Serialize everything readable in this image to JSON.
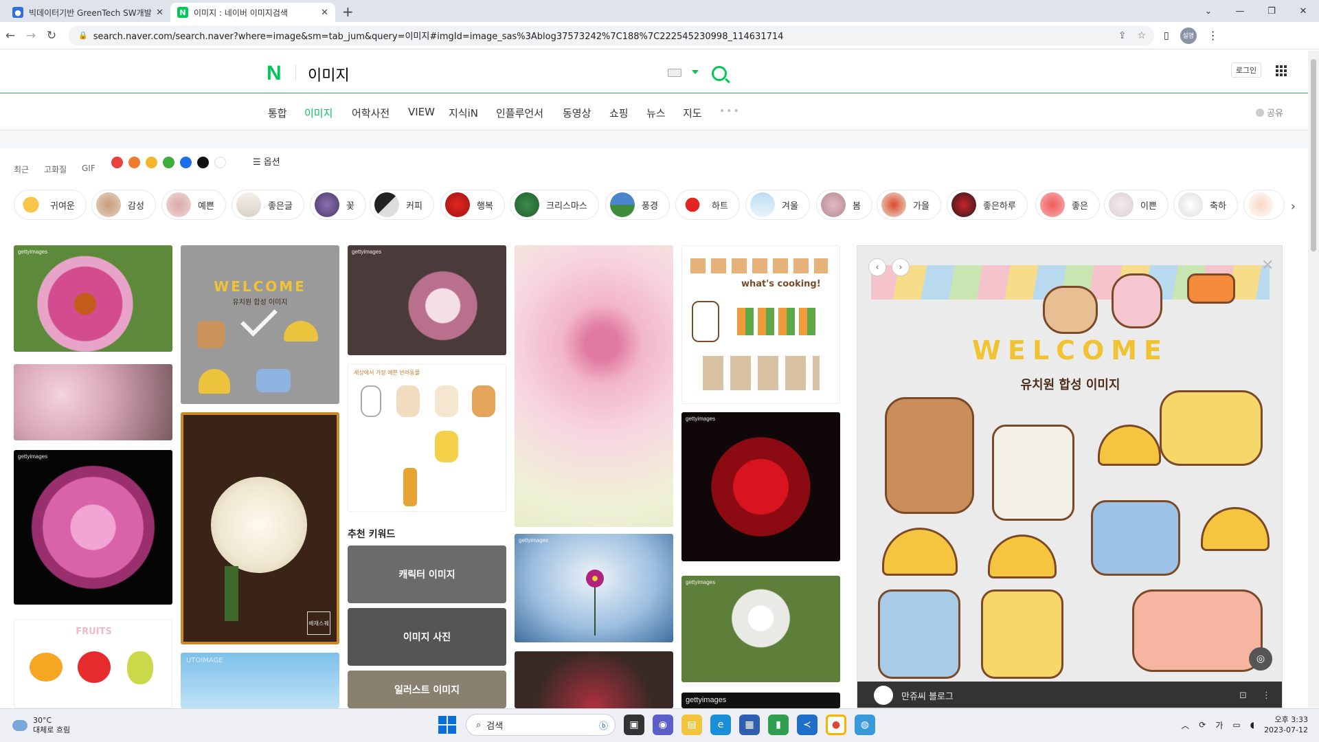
{
  "browser": {
    "tabs": [
      {
        "title": "빅데이터기반 GreenTech SW개발",
        "favicon": "blue-person-icon"
      },
      {
        "title": "이미지 : 네이버 이미지검색",
        "favicon": "naver-n-icon"
      }
    ],
    "url": "search.naver.com/search.naver?where=image&sm=tab_jum&query=이미지#imgId=image_sas%3Ablog37573242%7C188%7C222545230998_114631714",
    "profile_initial": "설명"
  },
  "naver": {
    "logo": "N",
    "query": "이미지",
    "login": "로그인",
    "tabs": [
      "통합",
      "이미지",
      "어학사전",
      "VIEW",
      "지식iN",
      "인플루언서",
      "동영상",
      "쇼핑",
      "뉴스",
      "지도",
      "•••"
    ],
    "active_tab": "이미지",
    "share": "공유",
    "filters": [
      "최근",
      "고화질",
      "GIF"
    ],
    "color_filters": [
      "#e8423c",
      "#f07a30",
      "#f3b52b",
      "#3cae3c",
      "#1d6ee8",
      "#111111",
      "#ffffff"
    ],
    "options_label": "옵션",
    "chips": [
      "귀여운",
      "감성",
      "예쁜",
      "좋은글",
      "꽃",
      "커피",
      "행복",
      "크리스마스",
      "풍경",
      "하트",
      "겨울",
      "봄",
      "가을",
      "좋은하루",
      "좋은",
      "이쁜",
      "축하"
    ],
    "recommend_title": "추천 키워드",
    "recommend": [
      "캐릭터 이미지",
      "이미지 사진",
      "일러스트 이미지"
    ],
    "getty_label": "gettyimages",
    "card_texts": {
      "welcome": "WELCOME",
      "welcome_sub": "유치원 합성 이미지",
      "cooking": "what's cooking!",
      "fruits": "FRUITS",
      "puppies_header": "세상에서 가장 예쁜 반려동물",
      "stamp": "배재스퀘",
      "utoimage": "UTOIMAGE"
    },
    "viewer": {
      "source": "만쥬씨 블로그",
      "title_art": "WELCOME",
      "subtitle_art": "유치원 합성 이미지"
    }
  },
  "taskbar": {
    "temp": "30°C",
    "weather": "대체로 흐림",
    "search": "검색",
    "ime": "가",
    "time": "오후 3:33",
    "date": "2023-07-12"
  }
}
